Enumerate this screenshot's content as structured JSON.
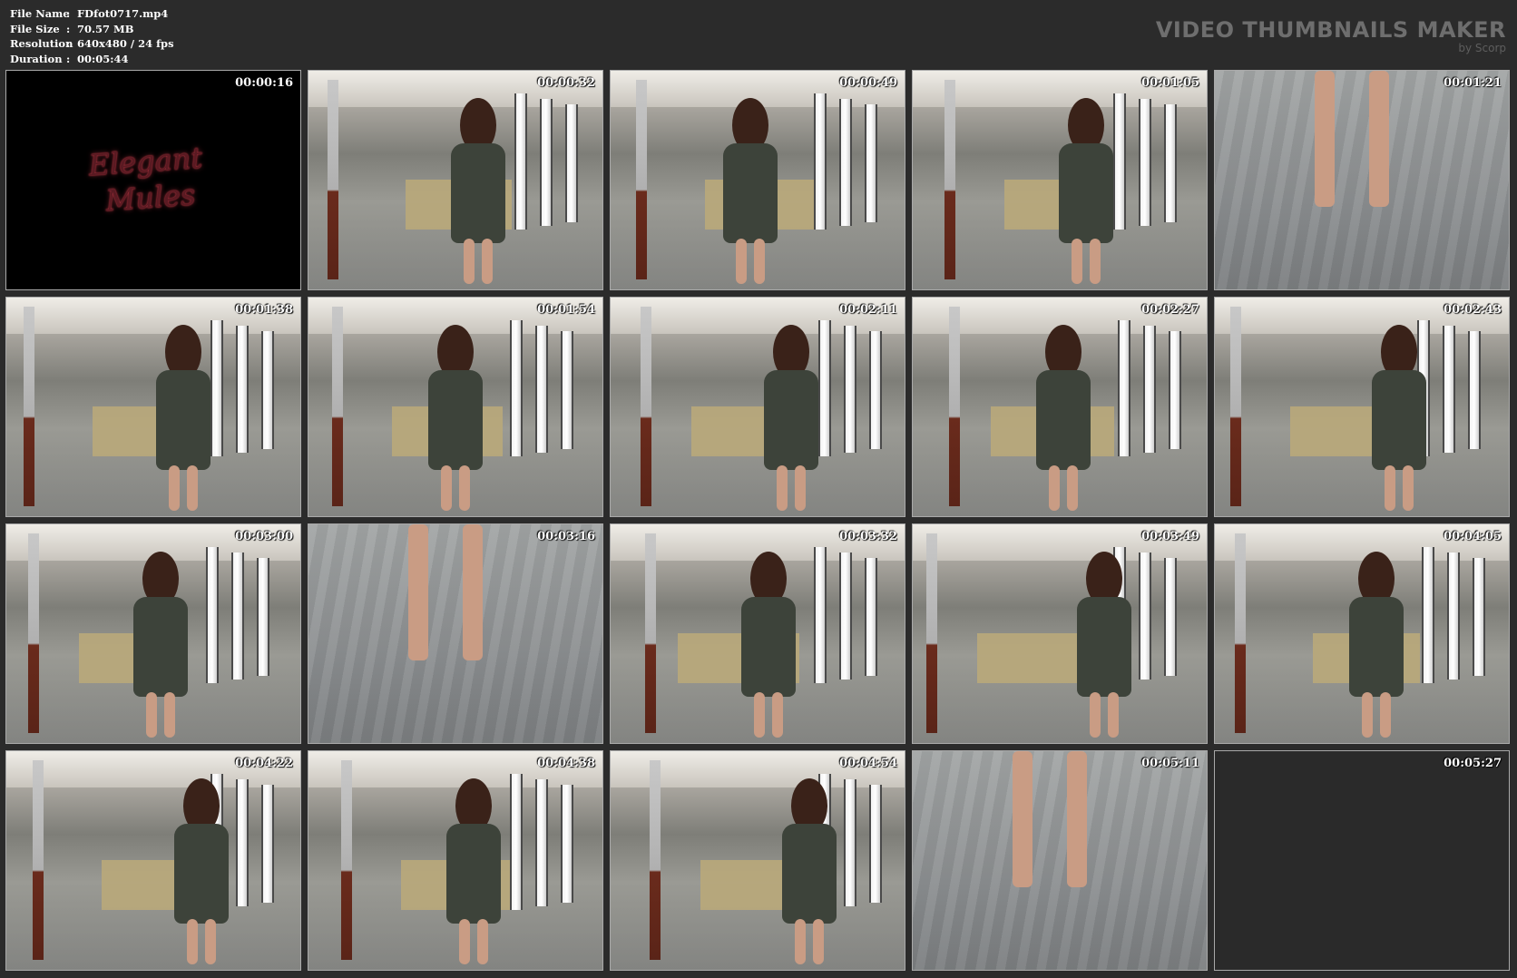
{
  "file_info": [
    {
      "key": "File Name",
      "sep": ":",
      "value": "FDfot0717.mp4"
    },
    {
      "key": "File Size",
      "sep": ":",
      "value": "70.57 MB"
    },
    {
      "key": "Resolution",
      "sep": ":",
      "value": "640x480 / 24 fps"
    },
    {
      "key": "Duration",
      "sep": ":",
      "value": "00:05:44"
    }
  ],
  "brand": {
    "title": "VIDEO THUMBNAILS MAKER",
    "subtitle": "by Scorp"
  },
  "thumbnails": [
    {
      "time": "00:00:16",
      "scene": "black",
      "logo": [
        "Elegant",
        "Mules"
      ]
    },
    {
      "time": "00:00:32",
      "scene": "room"
    },
    {
      "time": "00:00:49",
      "scene": "room"
    },
    {
      "time": "00:01:05",
      "scene": "room"
    },
    {
      "time": "00:01:21",
      "scene": "floor"
    },
    {
      "time": "00:01:38",
      "scene": "room"
    },
    {
      "time": "00:01:54",
      "scene": "room"
    },
    {
      "time": "00:02:11",
      "scene": "room"
    },
    {
      "time": "00:02:27",
      "scene": "room"
    },
    {
      "time": "00:02:43",
      "scene": "room"
    },
    {
      "time": "00:03:00",
      "scene": "room"
    },
    {
      "time": "00:03:16",
      "scene": "floor"
    },
    {
      "time": "00:03:32",
      "scene": "room"
    },
    {
      "time": "00:03:49",
      "scene": "room"
    },
    {
      "time": "00:04:05",
      "scene": "room"
    },
    {
      "time": "00:04:22",
      "scene": "room"
    },
    {
      "time": "00:04:38",
      "scene": "room"
    },
    {
      "time": "00:04:54",
      "scene": "room"
    },
    {
      "time": "00:05:11",
      "scene": "floor"
    },
    {
      "time": "00:05:27",
      "scene": "dark"
    }
  ]
}
